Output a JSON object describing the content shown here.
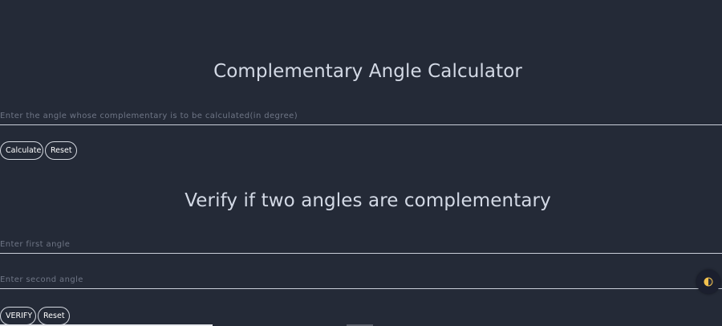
{
  "calculator": {
    "title": "Complementary Angle Calculator",
    "angle_input": {
      "placeholder": "Enter the angle whose complementary is to be calculated(in degree)",
      "value": ""
    },
    "calculate_label": "Calculate",
    "reset_label": "Reset"
  },
  "verify": {
    "title": "Verify if two angles are complementary",
    "first_input": {
      "placeholder": "Enter first angle",
      "value": ""
    },
    "second_input": {
      "placeholder": "Enter second angle",
      "value": ""
    },
    "verify_label": "VERIFY",
    "reset_label": "Reset"
  },
  "theme_toggle": {
    "icon": "half-circle-theme-icon",
    "colors": {
      "light": "#f2c14e",
      "dark": "#1b1f2e"
    }
  },
  "colors": {
    "background": "#242a37",
    "heading": "#d3d9e5",
    "placeholder": "#6f7686",
    "border": "#c9ced8"
  }
}
